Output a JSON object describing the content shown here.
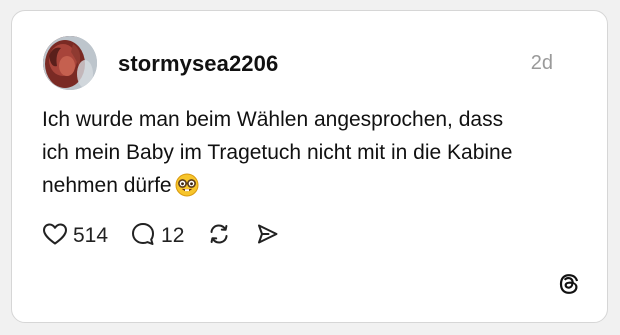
{
  "post": {
    "username": "stormysea2206",
    "timestamp": "2d",
    "text_lines": [
      "Ich wurde man beim Wählen angesprochen, dass",
      "ich mein Baby im Tragetuch nicht mit in die Kabine",
      "nehmen dürfe"
    ],
    "emoji": "nerd-face-emoji"
  },
  "actions": {
    "likes": "514",
    "replies": "12",
    "like_icon": "heart-icon",
    "reply_icon": "speech-bubble-icon",
    "repost_icon": "repost-icon",
    "share_icon": "send-icon"
  },
  "brand": {
    "icon": "threads-logo"
  }
}
